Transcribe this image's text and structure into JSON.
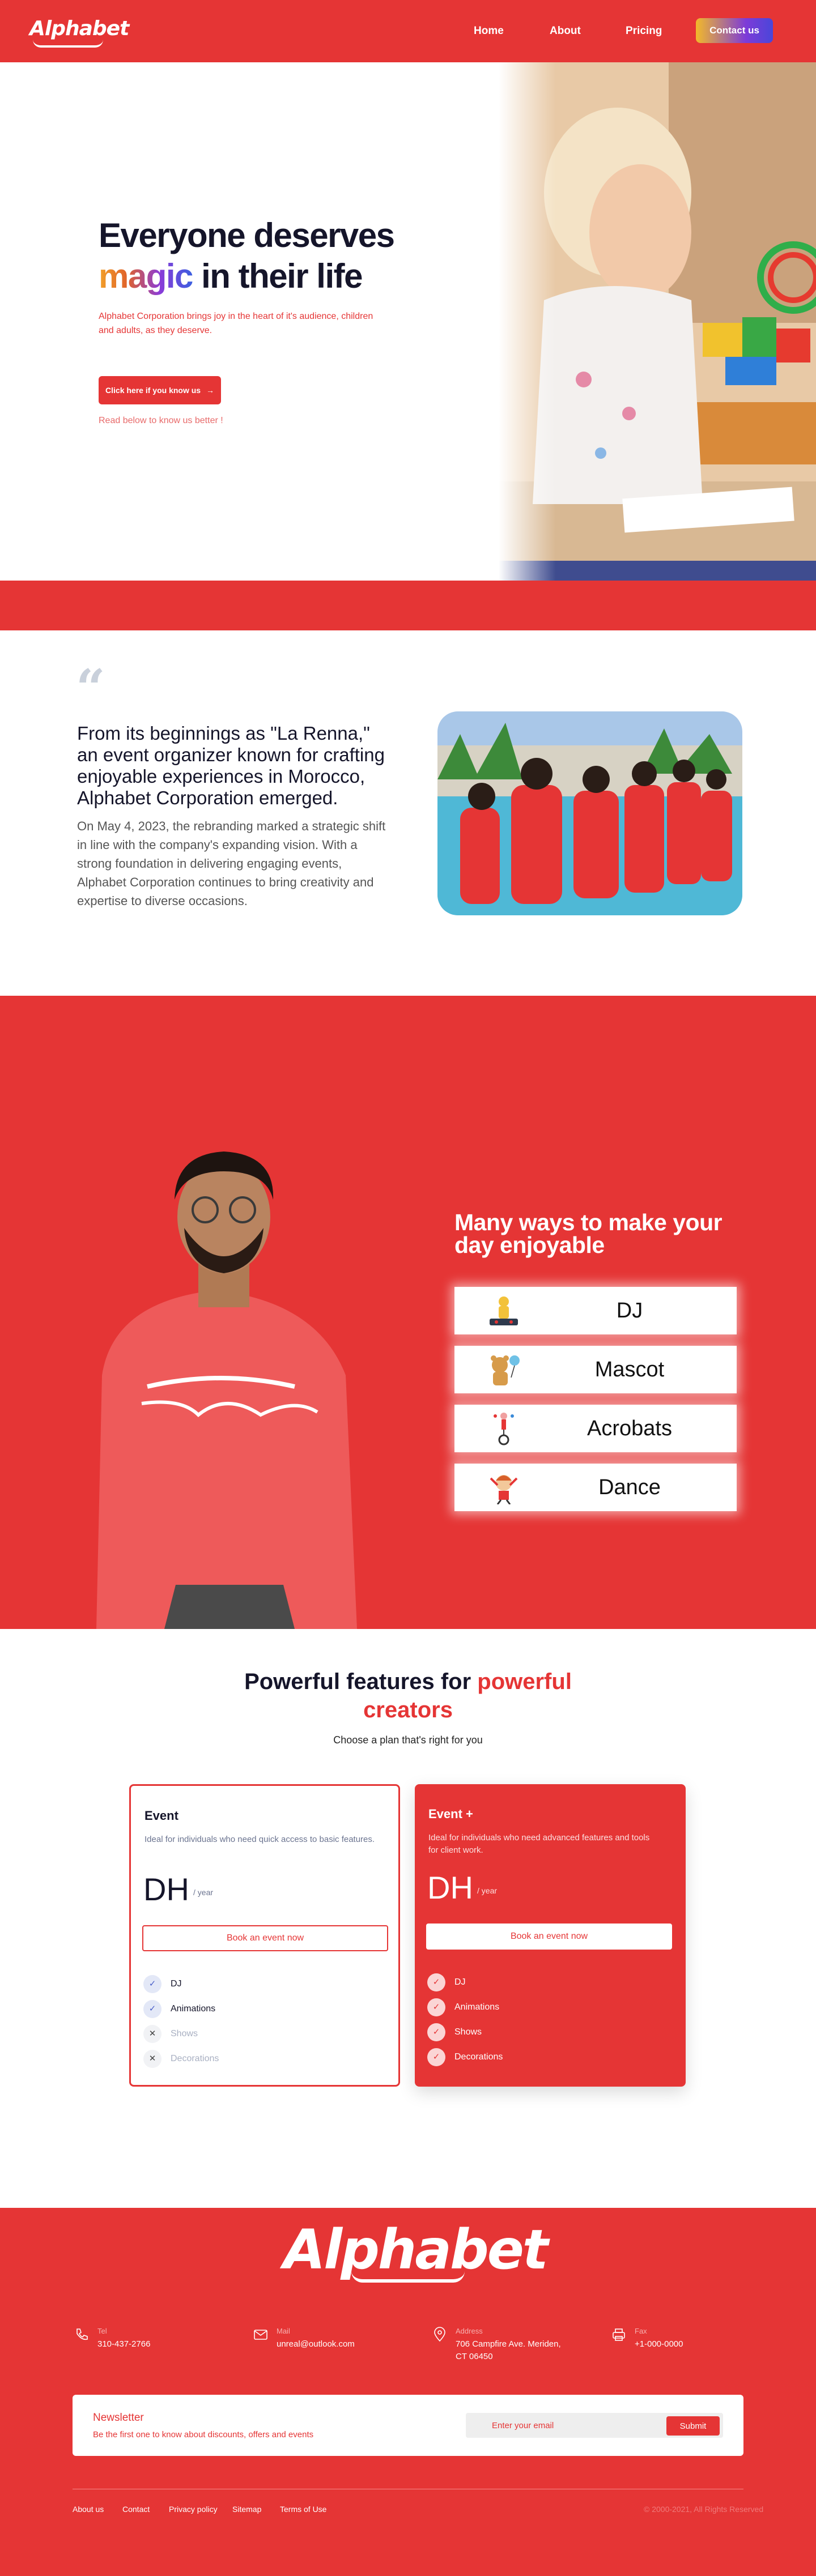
{
  "nav": {
    "logo": "Alphabet",
    "links": [
      "Home",
      "About",
      "Pricing"
    ],
    "contact_label": "Contact us"
  },
  "hero": {
    "title_line1": "Everyone deserves",
    "title_magic": "magic",
    "title_rest": "in their life",
    "description": "Alphabet Corporation brings joy in the heart of it's audience, children and adults, as they deserve.",
    "cta_label": "Click here if you know us",
    "cta_arrow": "→",
    "read_more": "Read below to know us better !"
  },
  "about": {
    "quote_mark": "“",
    "title": "From its beginnings as \"La Renna,\" an event organizer known for crafting enjoyable experiences in Morocco, Alphabet Corporation emerged.",
    "description": "On May 4, 2023, the rebranding marked a strategic shift in line with the company's expanding vision. With a strong foundation in delivering engaging events, Alphabet Corporation continues to bring creativity and expertise to diverse occasions."
  },
  "services": {
    "title": "Many ways to make your day enjoyable",
    "items": [
      {
        "label": "DJ",
        "icon": "dj-icon"
      },
      {
        "label": "Mascot",
        "icon": "mascot-icon"
      },
      {
        "label": "Acrobats",
        "icon": "unicycle-icon"
      },
      {
        "label": "Dance",
        "icon": "dancer-icon"
      }
    ]
  },
  "pricing": {
    "title_main": "Powerful features for",
    "title_accent1": "powerful",
    "title_accent2": "creators",
    "subtitle": "Choose a plan that's right for you",
    "plans": [
      {
        "name": "Event",
        "description": "Ideal for individuals who need quick access to basic features.",
        "price": "DH",
        "period": "/ year",
        "button": "Book an event now",
        "features": [
          {
            "label": "DJ",
            "included": true
          },
          {
            "label": "Animations",
            "included": true
          },
          {
            "label": "Shows",
            "included": false
          },
          {
            "label": "Decorations",
            "included": false
          }
        ]
      },
      {
        "name": "Event +",
        "description": "Ideal for individuals who need advanced features and tools for client work.",
        "price": "DH",
        "period": "/ year",
        "button": "Book an event now",
        "features": [
          {
            "label": "DJ",
            "included": true
          },
          {
            "label": "Animations",
            "included": true
          },
          {
            "label": "Shows",
            "included": true
          },
          {
            "label": "Decorations",
            "included": true
          }
        ]
      }
    ]
  },
  "footer": {
    "logo": "Alphabet",
    "contacts": [
      {
        "label": "Tel",
        "value": "310-437-2766",
        "icon": "phone-icon"
      },
      {
        "label": "Mail",
        "value": "unreal@outlook.com",
        "icon": "mail-icon"
      },
      {
        "label": "Address",
        "value_line1": "706 Campfire Ave. Meriden,",
        "value_line2": "CT 06450",
        "icon": "location-icon"
      },
      {
        "label": "Fax",
        "value": "+1-000-0000",
        "icon": "fax-icon"
      }
    ],
    "newsletter": {
      "title": "Newsletter",
      "description": "Be the first one to know about discounts, offers and events",
      "placeholder": "Enter your email",
      "button": "Submit"
    },
    "links": [
      "About us",
      "Contact",
      "Privacy policy",
      "Sitemap",
      "Terms of Use"
    ],
    "copyright": "© 2000-2021, All Rights Reserved"
  },
  "colors": {
    "brand_red": "#e53535",
    "dark_text": "#15152a",
    "gradient_start": "#f2b92a",
    "gradient_end": "#4a46d9"
  }
}
